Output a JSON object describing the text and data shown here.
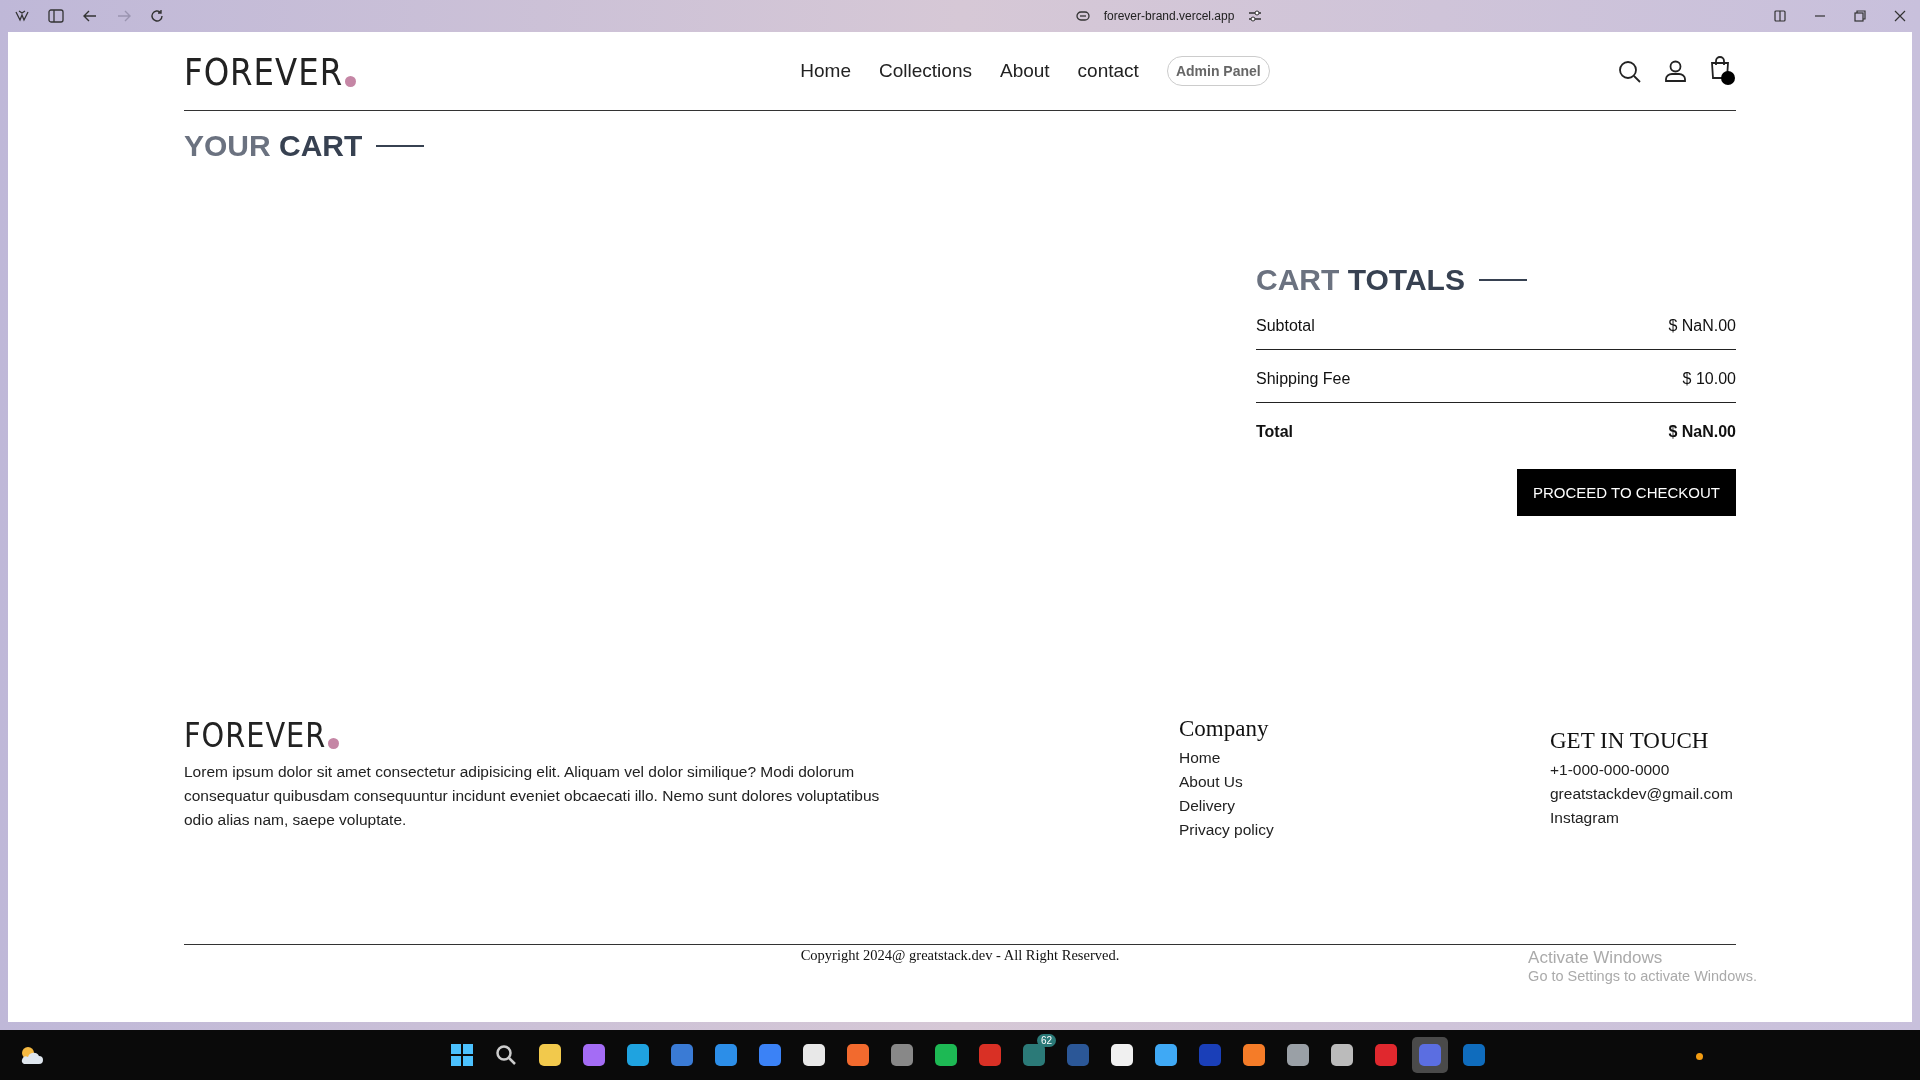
{
  "browser": {
    "url": "forever-brand.vercel.app",
    "forward_disabled": true
  },
  "header": {
    "logo": "FOREVER",
    "nav": [
      {
        "label": "Home"
      },
      {
        "label": "Collections"
      },
      {
        "label": "About"
      },
      {
        "label": "contact"
      }
    ],
    "admin_button": "Admin Panel"
  },
  "cart": {
    "title_light": "YOUR",
    "title_dark": "CART"
  },
  "totals": {
    "title_light": "CART",
    "title_dark": "TOTALS",
    "rows": [
      {
        "kind": "line",
        "label": "Subtotal",
        "value": "$ NaN.00"
      },
      {
        "kind": "line",
        "label": "Shipping Fee",
        "value": "$ 10.00"
      },
      {
        "kind": "total",
        "label": "Total",
        "value": "$ NaN.00"
      }
    ],
    "checkout_button": "PROCEED TO CHECKOUT"
  },
  "footer": {
    "logo": "FOREVER",
    "about": "Lorem ipsum dolor sit amet consectetur adipisicing elit. Aliquam vel dolor similique? Modi dolorum consequatur quibusdam consequuntur incidunt eveniet obcaecati illo. Nemo sunt dolores voluptatibus odio alias nam, saepe voluptate.",
    "company": {
      "title": "Company",
      "links": [
        "Home",
        "About Us",
        "Delivery",
        "Privacy policy"
      ]
    },
    "contact": {
      "title": "GET IN TOUCH",
      "items": [
        "+1-000-000-0000",
        "greatstackdev@gmail.com",
        "Instagram"
      ]
    },
    "copyright": "Copyright 2024@ greatstack.dev - All Right Reserved."
  },
  "os_notice": {
    "title": "Activate Windows",
    "subtitle": "Go to Settings to activate Windows."
  },
  "taskbar": {
    "apps": [
      {
        "kind": "start",
        "color": "#4cc2ff",
        "selected": false
      },
      {
        "kind": "search",
        "color": "#cccccc",
        "selected": false
      },
      {
        "kind": "app",
        "color": "#f2c94c",
        "selected": false
      },
      {
        "kind": "app",
        "color": "#a46cf5",
        "selected": false
      },
      {
        "kind": "app",
        "color": "#1fa3e0",
        "selected": false
      },
      {
        "kind": "app",
        "color": "#3a7bd5",
        "selected": false
      },
      {
        "kind": "app",
        "color": "#2c8ee8",
        "selected": false
      },
      {
        "kind": "app",
        "color": "#3b82f6",
        "selected": false
      },
      {
        "kind": "app",
        "color": "#e8e8e8",
        "selected": false
      },
      {
        "kind": "app",
        "color": "#f26a2e",
        "selected": false
      },
      {
        "kind": "app",
        "color": "#888888",
        "selected": false
      },
      {
        "kind": "app",
        "color": "#1db954",
        "selected": false
      },
      {
        "kind": "app",
        "color": "#d93025",
        "selected": false
      },
      {
        "kind": "app",
        "color": "#2b7a78",
        "selected": false,
        "badge": "62"
      },
      {
        "kind": "app",
        "color": "#2b5797",
        "selected": false
      },
      {
        "kind": "app",
        "color": "#f0f0f0",
        "selected": false
      },
      {
        "kind": "app",
        "color": "#3fa9f5",
        "selected": false
      },
      {
        "kind": "app",
        "color": "#1a3fb8",
        "selected": false
      },
      {
        "kind": "app",
        "color": "#f57c28",
        "selected": false
      },
      {
        "kind": "app",
        "color": "#9aa0a6",
        "selected": false
      },
      {
        "kind": "app",
        "color": "#bbbbbb",
        "selected": false
      },
      {
        "kind": "app",
        "color": "#e0282e",
        "selected": false
      },
      {
        "kind": "app",
        "color": "#5b6ee1",
        "selected": true
      },
      {
        "kind": "app",
        "color": "#0f6cbd",
        "selected": false
      }
    ]
  }
}
